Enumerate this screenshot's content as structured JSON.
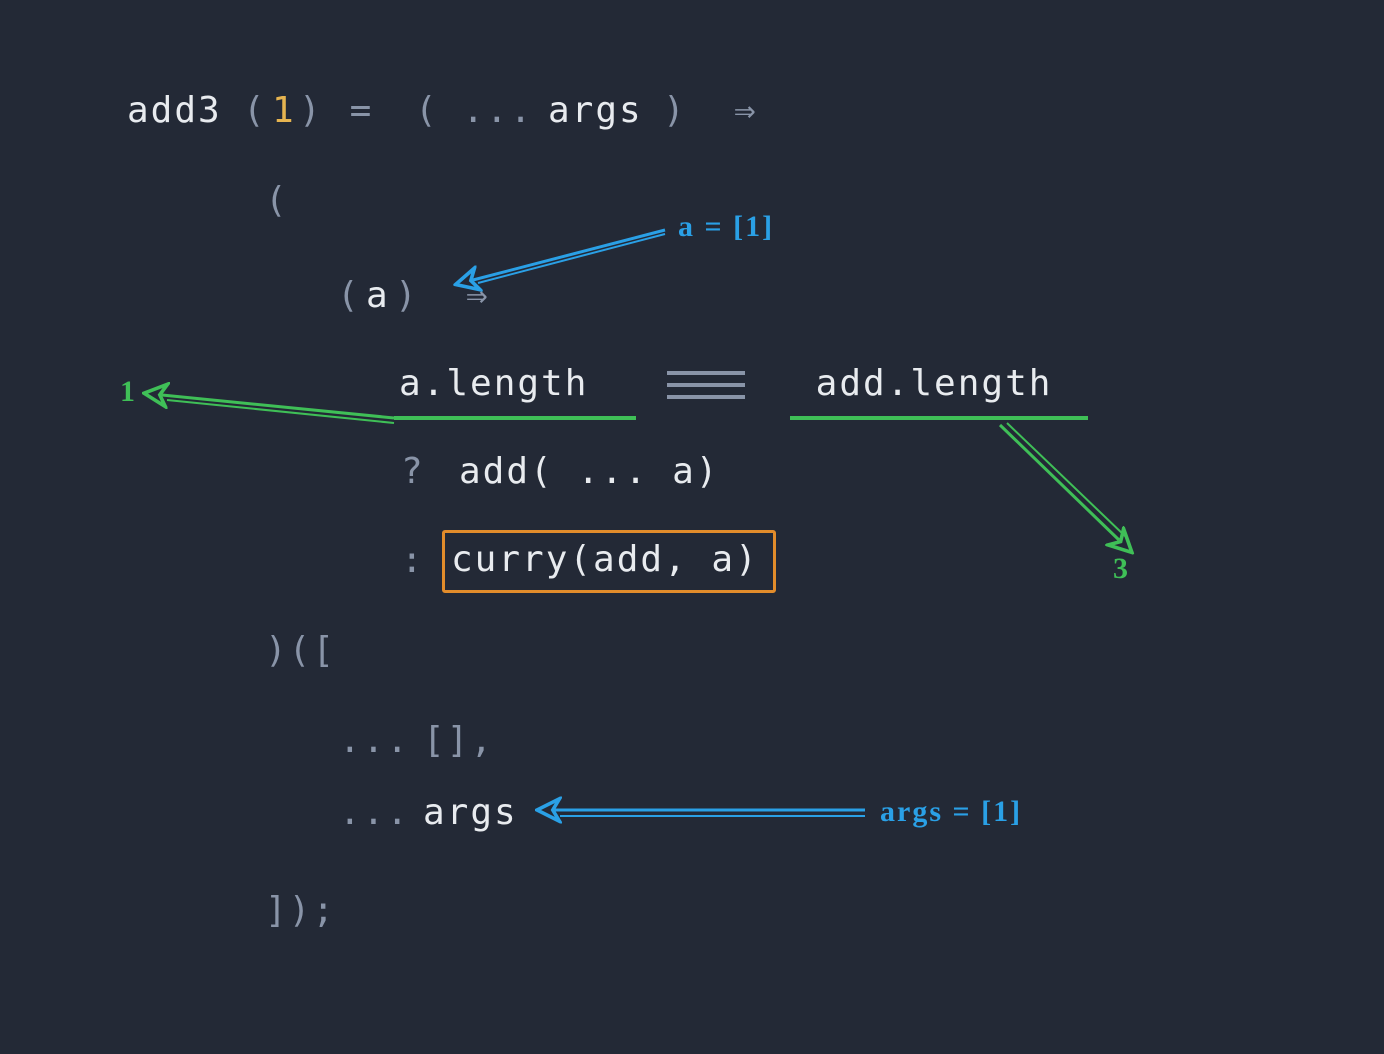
{
  "code": {
    "fn": "add3",
    "call_open": "(",
    "arg": "1",
    "call_close": ")",
    "assign": " = ",
    "rest_open": "( ... ",
    "args": "args",
    "rest_close": ")  ⇒",
    "iife_open": "(",
    "inner_a_open": "(",
    "inner_a": "a",
    "inner_a_close": ")  ⇒",
    "cond_left": "a.length ",
    "cond_eq": " ≡ ",
    "cond_right": " add.length",
    "ternary_q": "? ",
    "tern_true": "add( ... a)",
    "ternary_c": ":",
    "tern_false": "curry(add, a)",
    "iife_close": ")([",
    "spread1": "... ",
    "arr_empty": "[],",
    "spread2": "... ",
    "args2": "args",
    "end": "]);"
  },
  "annotations": {
    "a_eq": "a = [1]",
    "one": "1",
    "three": "3",
    "args_eq": "args = [1]"
  },
  "colors": {
    "bg": "#232936",
    "fg": "#e8ebef",
    "paren": "#8994a8",
    "num": "#e6b450",
    "green": "#3fbf57",
    "blue": "#2aa0e6",
    "box": "#e28c2b"
  }
}
